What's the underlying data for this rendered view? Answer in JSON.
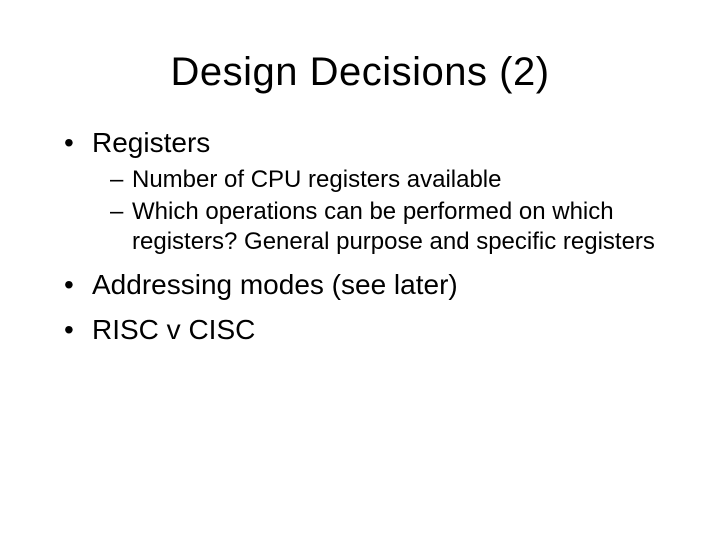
{
  "title": "Design Decisions (2)",
  "bullets": {
    "b1": "Registers",
    "b1_sub1": "Number of CPU registers available",
    "b1_sub2": "Which operations can be performed on which registers? General purpose and specific registers",
    "b2": "Addressing modes (see later)",
    "b3": "RISC v CISC"
  }
}
